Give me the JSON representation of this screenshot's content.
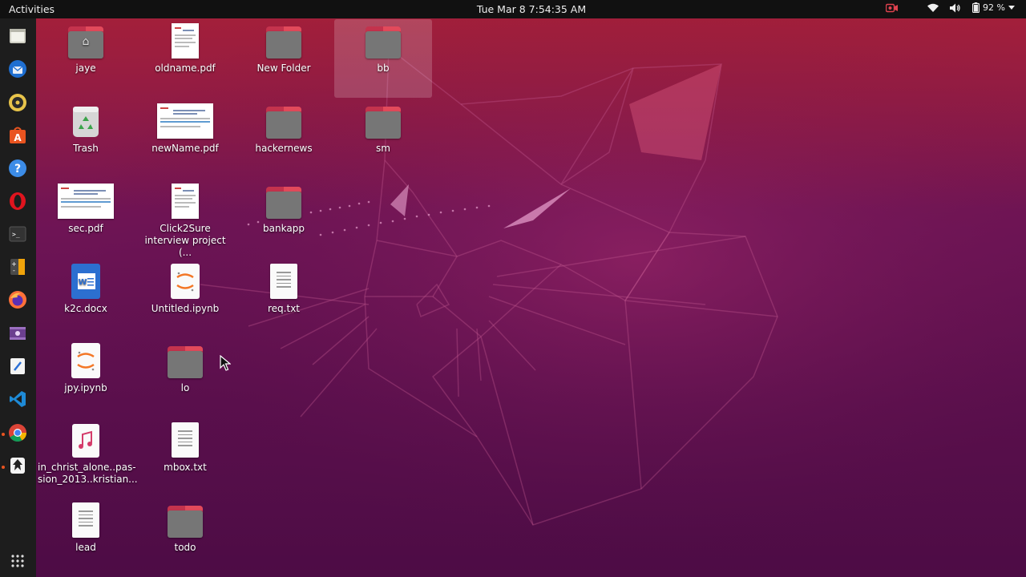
{
  "topbar": {
    "activities": "Activities",
    "clock": "Tue Mar 8  7:54:35 AM",
    "battery": "92 %"
  },
  "dock": {
    "items": [
      {
        "icon": "files-icon"
      },
      {
        "icon": "thunderbird-icon"
      },
      {
        "icon": "rhythmbox-icon"
      },
      {
        "icon": "software-center-icon"
      },
      {
        "icon": "help-icon"
      },
      {
        "icon": "opera-icon"
      },
      {
        "icon": "terminal-icon"
      },
      {
        "icon": "calculator-icon"
      },
      {
        "icon": "firefox-icon"
      },
      {
        "icon": "video-editor-icon"
      },
      {
        "icon": "text-editor-icon"
      },
      {
        "icon": "vscode-icon"
      },
      {
        "icon": "chrome-icon"
      },
      {
        "icon": "inkscape-icon"
      },
      {
        "icon": "show-apps-icon"
      }
    ]
  },
  "desktop": {
    "icons": [
      {
        "label": "jaye",
        "kind": "home-folder"
      },
      {
        "label": "oldname.pdf",
        "kind": "pdf"
      },
      {
        "label": "New Folder",
        "kind": "folder"
      },
      {
        "label": "bb",
        "kind": "folder"
      },
      {
        "label": "Trash",
        "kind": "trash"
      },
      {
        "label": "newName.pdf",
        "kind": "pdf-wide"
      },
      {
        "label": "hackernews",
        "kind": "folder"
      },
      {
        "label": "sm",
        "kind": "folder"
      },
      {
        "label": "sec.pdf",
        "kind": "pdf-wide"
      },
      {
        "label": "Click2Sure interview project (...",
        "kind": "pdf"
      },
      {
        "label": "bankapp",
        "kind": "folder"
      },
      {
        "label": "k2c.docx",
        "kind": "docx"
      },
      {
        "label": "Untitled.ipynb",
        "kind": "ipynb"
      },
      {
        "label": "req.txt",
        "kind": "text"
      },
      {
        "label": "jpy.ipynb",
        "kind": "ipynb"
      },
      {
        "label": "lo",
        "kind": "folder"
      },
      {
        "label": "in_christ_alone..pas-sion_2013..kristian...",
        "kind": "audio"
      },
      {
        "label": "mbox.txt",
        "kind": "text"
      },
      {
        "label": "lead",
        "kind": "text"
      },
      {
        "label": "todo",
        "kind": "folder"
      }
    ]
  }
}
